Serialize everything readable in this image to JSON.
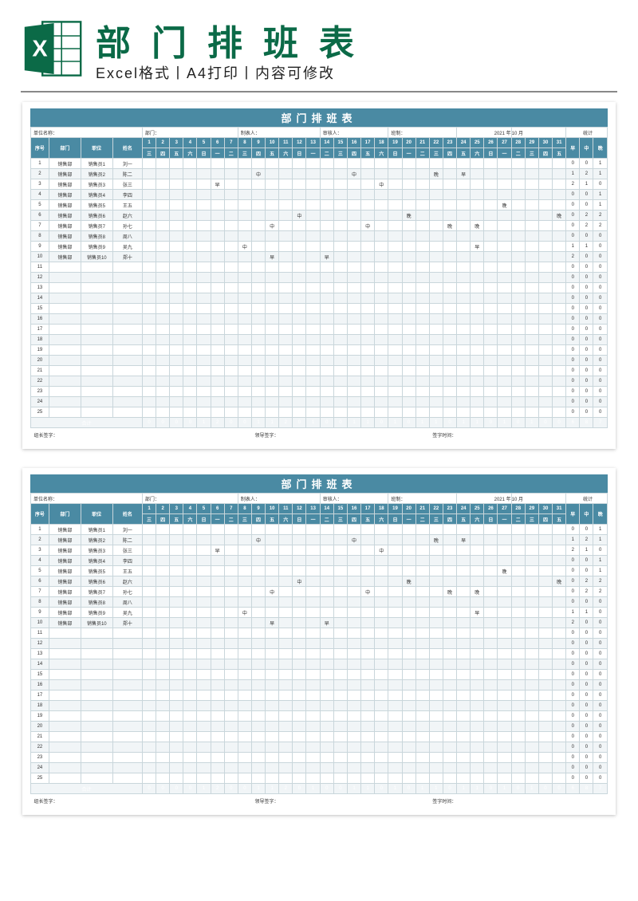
{
  "header": {
    "big_title": "部门排班表",
    "subtitle": "Excel格式丨A4打印丨内容可修改"
  },
  "sheet": {
    "title": "部门排班表",
    "info": {
      "unit_label": "单位名称：",
      "dept_label": "部门：",
      "maker_label": "制表人：",
      "auditor_label": "审核人：",
      "rule_label": "班制：",
      "year_label": "年",
      "month_label": "月",
      "year": "2021",
      "month": "10",
      "stat_label": "统计"
    },
    "columns": {
      "idx": "序号",
      "dept": "部门",
      "job": "职位",
      "name": "姓名",
      "stats": [
        "早",
        "中",
        "晚"
      ]
    },
    "days": [
      "1",
      "2",
      "3",
      "4",
      "5",
      "6",
      "7",
      "8",
      "9",
      "10",
      "11",
      "12",
      "13",
      "14",
      "15",
      "16",
      "17",
      "18",
      "19",
      "20",
      "21",
      "22",
      "23",
      "24",
      "25",
      "26",
      "27",
      "28",
      "29",
      "30",
      "31"
    ],
    "weekdays": [
      "三",
      "四",
      "五",
      "六",
      "日",
      "一",
      "二",
      "三",
      "四",
      "五",
      "六",
      "日",
      "一",
      "二",
      "三",
      "四",
      "五",
      "六",
      "日",
      "一",
      "二",
      "三",
      "四",
      "五",
      "六",
      "日",
      "一",
      "二",
      "三",
      "四",
      "五"
    ],
    "rows": [
      {
        "idx": 1,
        "dept": "销售部",
        "job": "销售员1",
        "name": "刘一",
        "cells": [
          "",
          "",
          "",
          "",
          "",
          "",
          "",
          "",
          "",
          "",
          "",
          "",
          "",
          "",
          "",
          "",
          "",
          "",
          "",
          "",
          "",
          "",
          "",
          "",
          "",
          "",
          "",
          "",
          "",
          "",
          ""
        ],
        "stats": [
          0,
          0,
          1
        ]
      },
      {
        "idx": 2,
        "dept": "销售部",
        "job": "销售员2",
        "name": "陈二",
        "cells": [
          "",
          "",
          "",
          "",
          "",
          "",
          "",
          "",
          "中",
          "",
          "",
          "",
          "",
          "",
          "",
          "中",
          "",
          "",
          "",
          "",
          "",
          "晚",
          "",
          "早",
          "",
          "",
          "",
          "",
          "",
          "",
          ""
        ],
        "stats": [
          1,
          2,
          1
        ]
      },
      {
        "idx": 3,
        "dept": "销售部",
        "job": "销售员3",
        "name": "张三",
        "cells": [
          "",
          "",
          "",
          "",
          "",
          "早",
          "",
          "",
          "",
          "",
          "",
          "",
          "",
          "",
          "",
          "",
          "",
          "中",
          "",
          "",
          "",
          "",
          "",
          "",
          "",
          "",
          "",
          "",
          "",
          "",
          ""
        ],
        "stats": [
          2,
          1,
          0
        ]
      },
      {
        "idx": 4,
        "dept": "销售部",
        "job": "销售员4",
        "name": "李四",
        "cells": [
          "",
          "",
          "",
          "",
          "",
          "",
          "",
          "",
          "",
          "",
          "",
          "",
          "",
          "",
          "",
          "",
          "",
          "",
          "",
          "",
          "",
          "",
          "",
          "",
          "",
          "",
          "",
          "",
          "",
          "",
          ""
        ],
        "stats": [
          0,
          0,
          1
        ]
      },
      {
        "idx": 5,
        "dept": "销售部",
        "job": "销售员5",
        "name": "王五",
        "cells": [
          "",
          "",
          "",
          "",
          "",
          "",
          "",
          "",
          "",
          "",
          "",
          "",
          "",
          "",
          "",
          "",
          "",
          "",
          "",
          "",
          "",
          "",
          "",
          "",
          "",
          "",
          "晚",
          "",
          "",
          "",
          ""
        ],
        "stats": [
          0,
          0,
          1
        ]
      },
      {
        "idx": 6,
        "dept": "销售部",
        "job": "销售员6",
        "name": "赵六",
        "cells": [
          "",
          "",
          "",
          "",
          "",
          "",
          "",
          "",
          "",
          "",
          "",
          "中",
          "",
          "",
          "",
          "",
          "",
          "",
          "",
          "晚",
          "",
          "",
          "",
          "",
          "",
          "",
          "",
          "",
          "",
          "",
          "晚"
        ],
        "stats": [
          0,
          2,
          2
        ]
      },
      {
        "idx": 7,
        "dept": "销售部",
        "job": "销售员7",
        "name": "孙七",
        "cells": [
          "",
          "",
          "",
          "",
          "",
          "",
          "",
          "",
          "",
          "中",
          "",
          "",
          "",
          "",
          "",
          "",
          "中",
          "",
          "",
          "",
          "",
          "",
          "晚",
          "",
          "晚",
          "",
          "",
          "",
          "",
          "",
          ""
        ],
        "stats": [
          0,
          2,
          2
        ]
      },
      {
        "idx": 8,
        "dept": "销售部",
        "job": "销售员8",
        "name": "周八",
        "cells": [
          "",
          "",
          "",
          "",
          "",
          "",
          "",
          "",
          "",
          "",
          "",
          "",
          "",
          "",
          "",
          "",
          "",
          "",
          "",
          "",
          "",
          "",
          "",
          "",
          "",
          "",
          "",
          "",
          "",
          "",
          ""
        ],
        "stats": [
          0,
          0,
          0
        ]
      },
      {
        "idx": 9,
        "dept": "销售部",
        "job": "销售员9",
        "name": "吴九",
        "cells": [
          "",
          "",
          "",
          "",
          "",
          "",
          "",
          "中",
          "",
          "",
          "",
          "",
          "",
          "",
          "",
          "",
          "",
          "",
          "",
          "",
          "",
          "",
          "",
          "",
          "早",
          "",
          "",
          "",
          "",
          "",
          ""
        ],
        "stats": [
          1,
          1,
          0
        ]
      },
      {
        "idx": 10,
        "dept": "销售部",
        "job": "销售员10",
        "name": "郑十",
        "cells": [
          "",
          "",
          "",
          "",
          "",
          "",
          "",
          "",
          "",
          "早",
          "",
          "",
          "",
          "早",
          "",
          "",
          "",
          "",
          "",
          "",
          "",
          "",
          "",
          "",
          "",
          "",
          "",
          "",
          "",
          "",
          ""
        ],
        "stats": [
          2,
          0,
          0
        ]
      },
      {
        "idx": 11,
        "cells": [],
        "stats": [
          0,
          0,
          0
        ]
      },
      {
        "idx": 12,
        "cells": [],
        "stats": [
          0,
          0,
          0
        ]
      },
      {
        "idx": 13,
        "cells": [],
        "stats": [
          0,
          0,
          0
        ]
      },
      {
        "idx": 14,
        "cells": [],
        "stats": [
          0,
          0,
          0
        ]
      },
      {
        "idx": 15,
        "cells": [],
        "stats": [
          0,
          0,
          0
        ]
      },
      {
        "idx": 16,
        "cells": [],
        "stats": [
          0,
          0,
          0
        ]
      },
      {
        "idx": 17,
        "cells": [],
        "stats": [
          0,
          0,
          0
        ]
      },
      {
        "idx": 18,
        "cells": [],
        "stats": [
          0,
          0,
          0
        ]
      },
      {
        "idx": 19,
        "cells": [],
        "stats": [
          0,
          0,
          0
        ]
      },
      {
        "idx": 20,
        "cells": [],
        "stats": [
          0,
          0,
          0
        ]
      },
      {
        "idx": 21,
        "cells": [],
        "stats": [
          0,
          0,
          0
        ]
      },
      {
        "idx": 22,
        "cells": [],
        "stats": [
          0,
          0,
          0
        ]
      },
      {
        "idx": 23,
        "cells": [],
        "stats": [
          0,
          0,
          0
        ]
      },
      {
        "idx": 24,
        "cells": [],
        "stats": [
          0,
          0,
          0
        ]
      },
      {
        "idx": 25,
        "cells": [],
        "stats": [
          0,
          0,
          0
        ]
      }
    ],
    "sum": {
      "label": "合计",
      "cells": [
        "0",
        "0",
        "0",
        "0",
        "1",
        "2",
        "0",
        "0",
        "1",
        "1",
        "2",
        "0",
        "1",
        "0",
        "0",
        "1",
        "1",
        "0",
        "1",
        "0",
        "1",
        "1",
        "0",
        "1",
        "1",
        "0",
        "1",
        "0",
        "1",
        "0",
        "0"
      ],
      "stats": [
        "6",
        "8",
        "7"
      ]
    },
    "signatures": {
      "leader": "组长签字：",
      "manager": "领导签字：",
      "time": "签字时间："
    }
  }
}
